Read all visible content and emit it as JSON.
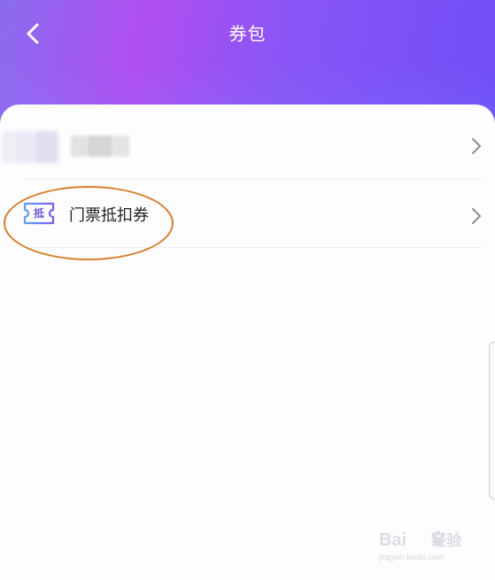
{
  "header": {
    "title": "券包",
    "back_icon": "chevron-left-icon",
    "gradient_colors": [
      "#8a6cf0",
      "#b04ff0",
      "#6f4ef7"
    ]
  },
  "list": {
    "items": [
      {
        "label": "",
        "blurred": true,
        "icon": "chevron-right-icon"
      },
      {
        "label": "门票抵扣券",
        "icon_glyph": "抵",
        "icon": "ticket-coupon-icon"
      }
    ]
  },
  "watermark": {
    "logo": "Bai",
    "logo_suffix": "经验",
    "sub": "jingyan.baidu.com"
  },
  "colors": {
    "highlight": "#d8812a",
    "icon_accent": "#6a58e6"
  }
}
